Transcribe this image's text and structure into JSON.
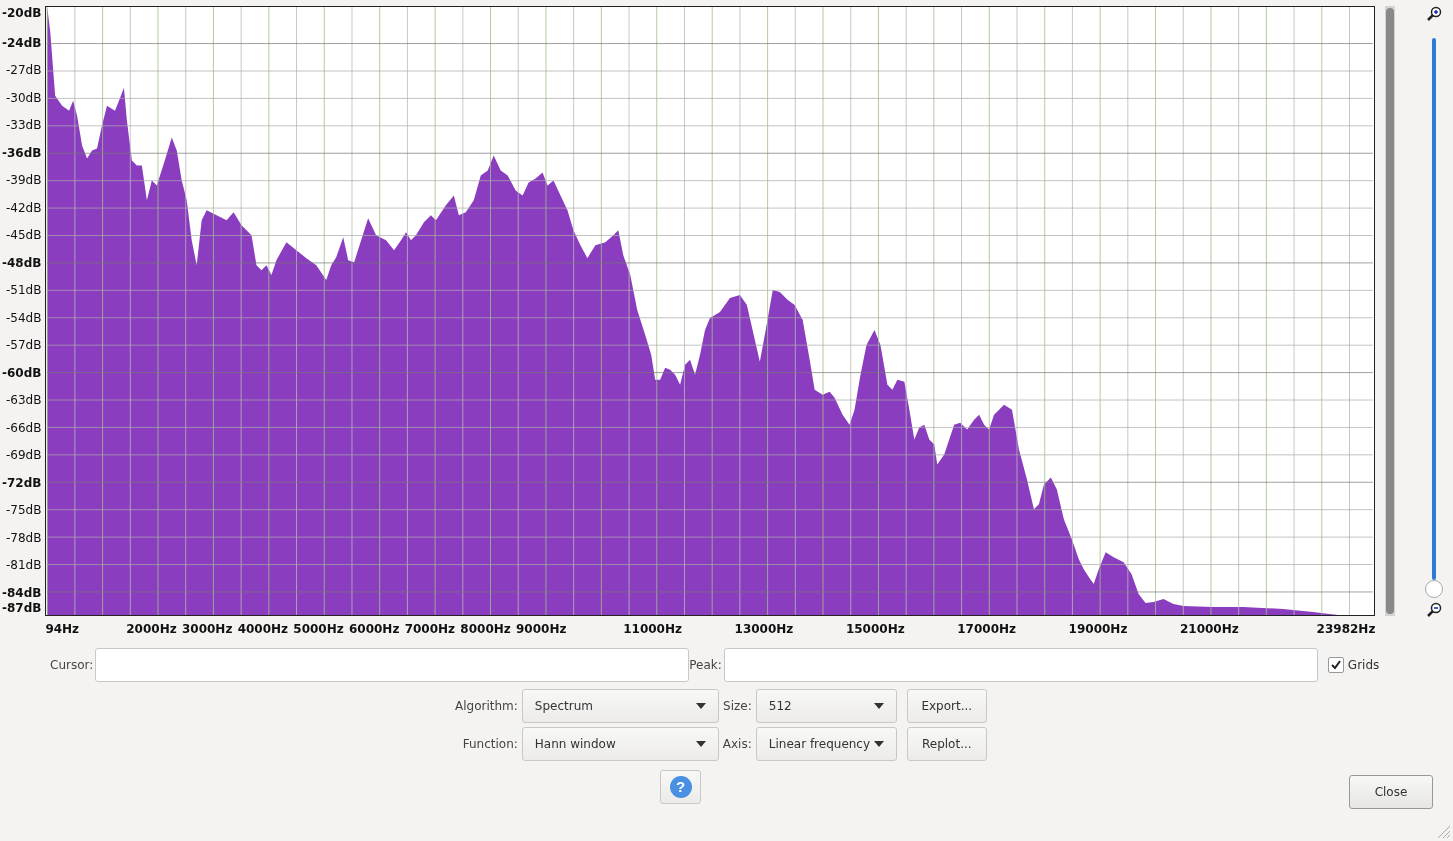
{
  "plot": {
    "y_axis_labels": [
      {
        "text": "-20dB",
        "major": true
      },
      {
        "text": "-24dB",
        "major": true
      },
      {
        "text": "-27dB",
        "major": false
      },
      {
        "text": "-30dB",
        "major": false
      },
      {
        "text": "-33dB",
        "major": false
      },
      {
        "text": "-36dB",
        "major": true
      },
      {
        "text": "-39dB",
        "major": false
      },
      {
        "text": "-42dB",
        "major": false
      },
      {
        "text": "-45dB",
        "major": false
      },
      {
        "text": "-48dB",
        "major": true
      },
      {
        "text": "-51dB",
        "major": false
      },
      {
        "text": "-54dB",
        "major": false
      },
      {
        "text": "-57dB",
        "major": false
      },
      {
        "text": "-60dB",
        "major": true
      },
      {
        "text": "-63dB",
        "major": false
      },
      {
        "text": "-66dB",
        "major": false
      },
      {
        "text": "-69dB",
        "major": false
      },
      {
        "text": "-72dB",
        "major": true
      },
      {
        "text": "-75dB",
        "major": false
      },
      {
        "text": "-78dB",
        "major": false
      },
      {
        "text": "-81dB",
        "major": false
      },
      {
        "text": "-84dB",
        "major": true
      },
      {
        "text": "-87dB",
        "major": true
      }
    ],
    "x_axis_labels": [
      "94Hz",
      "2000Hz",
      "3000Hz",
      "4000Hz",
      "5000Hz",
      "6000Hz",
      "7000Hz",
      "8000Hz",
      "9000Hz",
      "11000Hz",
      "13000Hz",
      "15000Hz",
      "17000Hz",
      "19000Hz",
      "21000Hz",
      "23982Hz"
    ],
    "grids": true
  },
  "zoom_slider": {
    "level": 0
  },
  "cursor": {
    "label": "Cursor:"
  },
  "peak": {
    "label": "Peak:"
  },
  "grids_checkbox": {
    "label": "Grids",
    "checked": true
  },
  "algorithm": {
    "label": "Algorithm:",
    "value": "Spectrum"
  },
  "size": {
    "label": "Size:",
    "value": "512"
  },
  "function": {
    "label": "Function:",
    "value": "Hann window"
  },
  "axis": {
    "label": "Axis:",
    "value": "Linear frequency"
  },
  "buttons": [
    "Export...",
    "Replot..."
  ],
  "help_button": {
    "label": "?"
  },
  "close_button": {
    "label": "Close"
  }
}
